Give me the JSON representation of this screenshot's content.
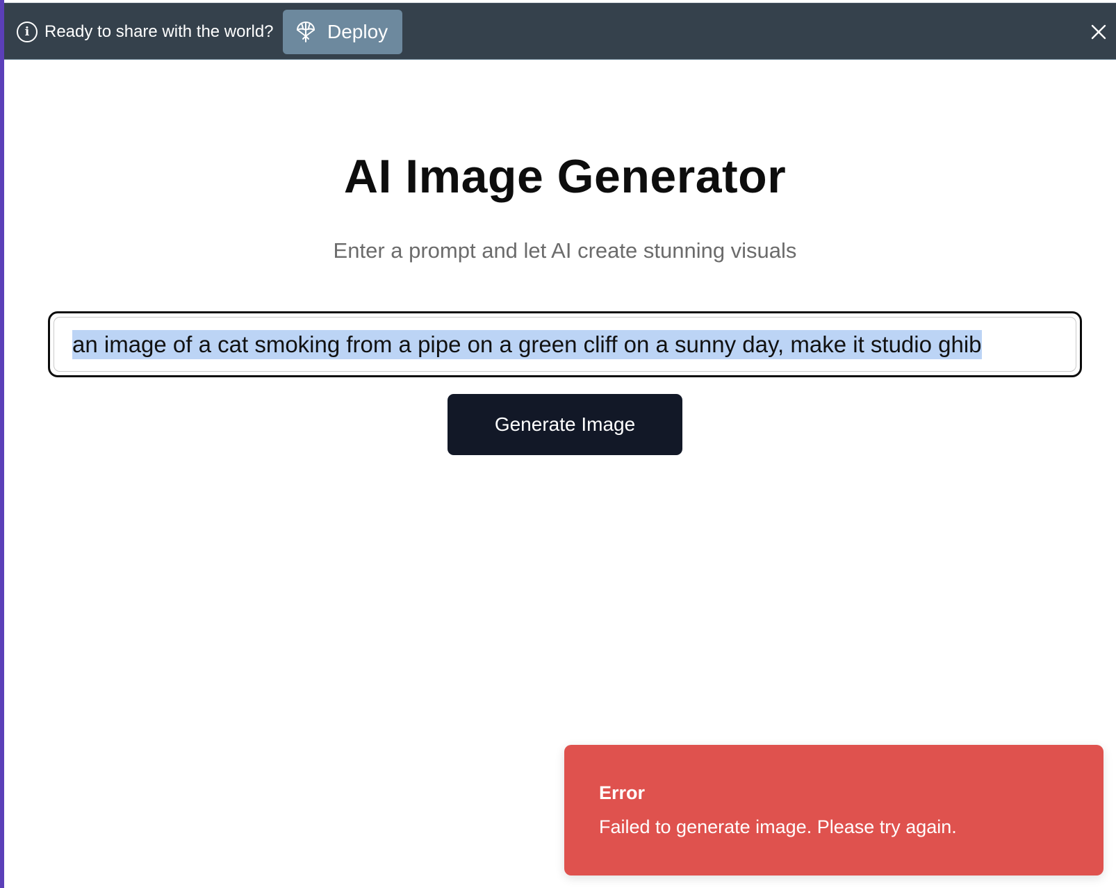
{
  "banner": {
    "message": "Ready to share with the world?",
    "deploy_label": "Deploy",
    "info_icon": "info-circle-icon",
    "deploy_icon": "deploy-parachute-icon",
    "close_icon": "close-icon",
    "colors": {
      "background": "#35414c",
      "deploy_button": "#6d899e"
    }
  },
  "main": {
    "title": "AI Image Generator",
    "subtitle": "Enter a prompt and let AI create stunning visuals",
    "prompt": {
      "value": "an image of a cat smoking from a pipe on a green cliff on a sunny day, make it studio ghib",
      "selected": true
    },
    "generate_label": "Generate Image"
  },
  "toast": {
    "title": "Error",
    "message": "Failed to generate image. Please try again.",
    "color": "#df524e"
  }
}
